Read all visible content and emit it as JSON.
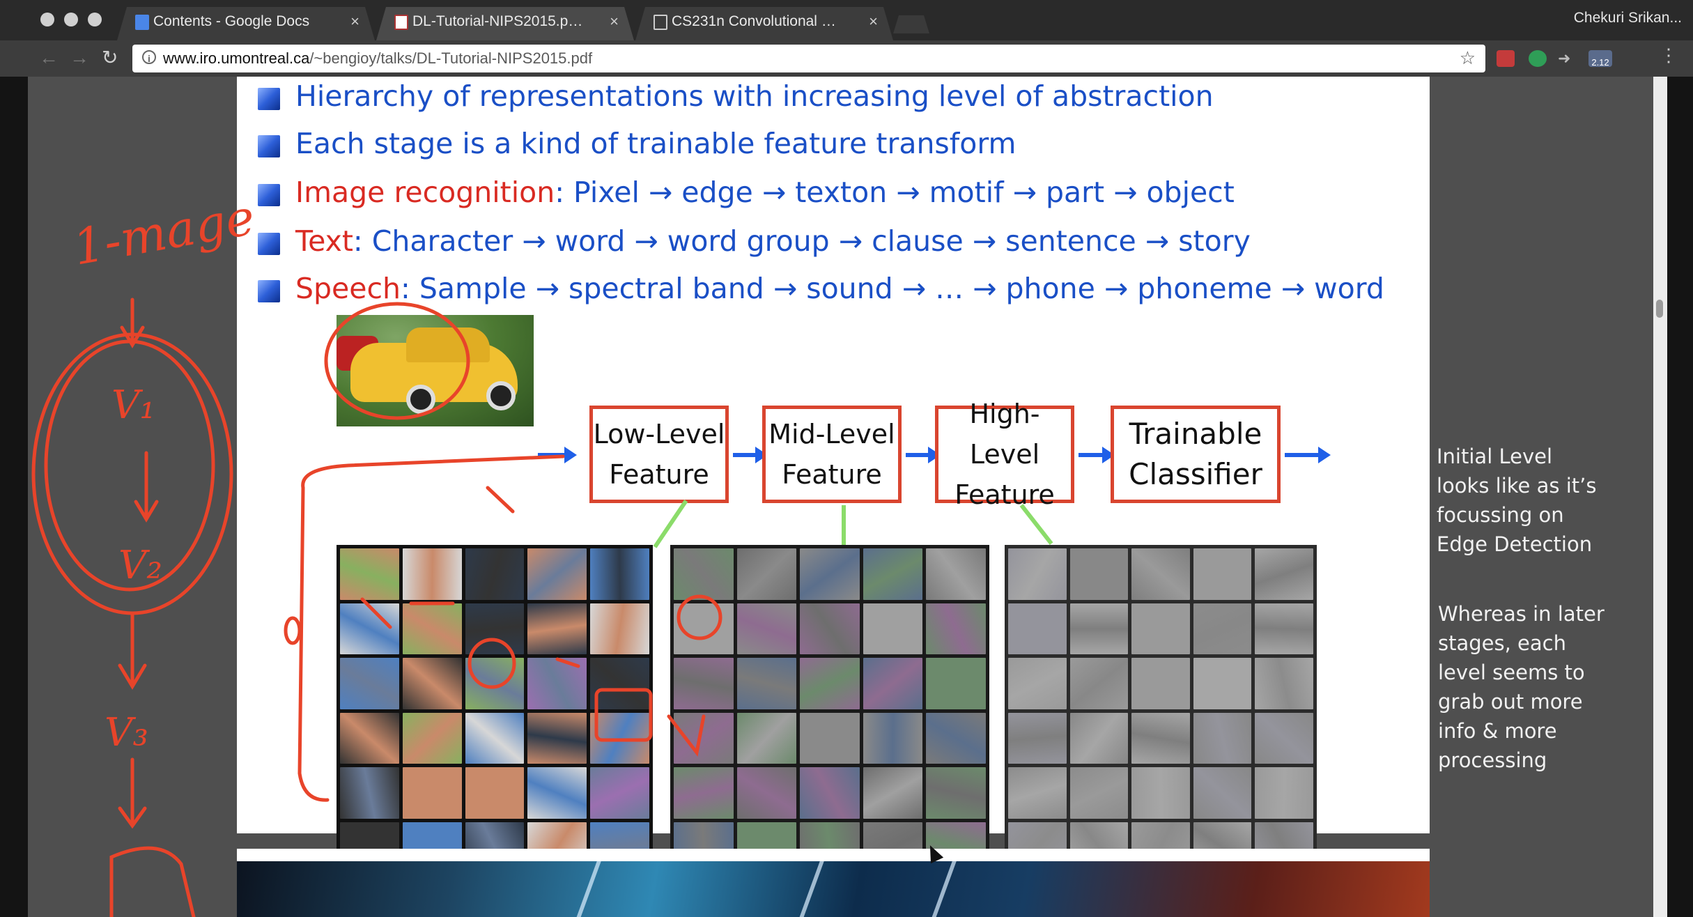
{
  "browser": {
    "tabs": [
      {
        "label": "Contents - Google Docs",
        "icon": "docs-icon",
        "color": "#4a86e8",
        "active": false
      },
      {
        "label": "DL-Tutorial-NIPS2015.pptx",
        "icon": "pptx-icon",
        "color": "#ffffff",
        "active": true
      },
      {
        "label": "CS231n Convolutional Neural Networks",
        "icon": "page-icon",
        "color": "#cccccc",
        "active": false
      }
    ],
    "close_glyph": "×",
    "profile": "Chekuri Srikan...",
    "address": {
      "domain": "www.iro.umontreal.ca",
      "path": "/~bengioy/talks/DL-Tutorial-NIPS2015.pdf"
    },
    "extension_badge": "2.12"
  },
  "slide": {
    "bullets": [
      {
        "prefix": "",
        "text": "Hierarchy of representations with increasing level of abstraction"
      },
      {
        "prefix": "",
        "text": "Each stage is a kind of trainable feature transform"
      },
      {
        "prefix": "Image recognition",
        "text": ": Pixel → edge → texton → motif → part → object"
      },
      {
        "prefix": "Text",
        "text": ": Character → word → word group → clause → sentence → story"
      },
      {
        "prefix": "Speech",
        "text": ": Sample → spectral band → sound → … → phone → phoneme → word"
      }
    ],
    "pipeline": [
      {
        "line1": "Low-Level",
        "line2": "Feature"
      },
      {
        "line1": "Mid-Level",
        "line2": "Feature"
      },
      {
        "line1": "High-Level",
        "line2": "Feature"
      },
      {
        "line1": "Trainable",
        "line2": "Classifier"
      }
    ]
  },
  "notes": {
    "first": [
      "Initial Level",
      "looks like as it’s",
      "focussing on",
      "Edge Detection"
    ],
    "second": [
      "Whereas in later",
      "stages, each",
      "level seems to",
      "grab out more",
      "info & more",
      "processing"
    ]
  },
  "handwriting": {
    "label": "1-mage",
    "v1": "V₁",
    "v2": "V₂",
    "v3": "V₃"
  },
  "colors": {
    "bullet_blue": "#1a4fc6",
    "highlight_red": "#d92a22",
    "box_border": "#d9452f",
    "arrow_blue": "#1f5fe8",
    "connector_green": "#8bdc6a",
    "ink": "#e8442a"
  }
}
